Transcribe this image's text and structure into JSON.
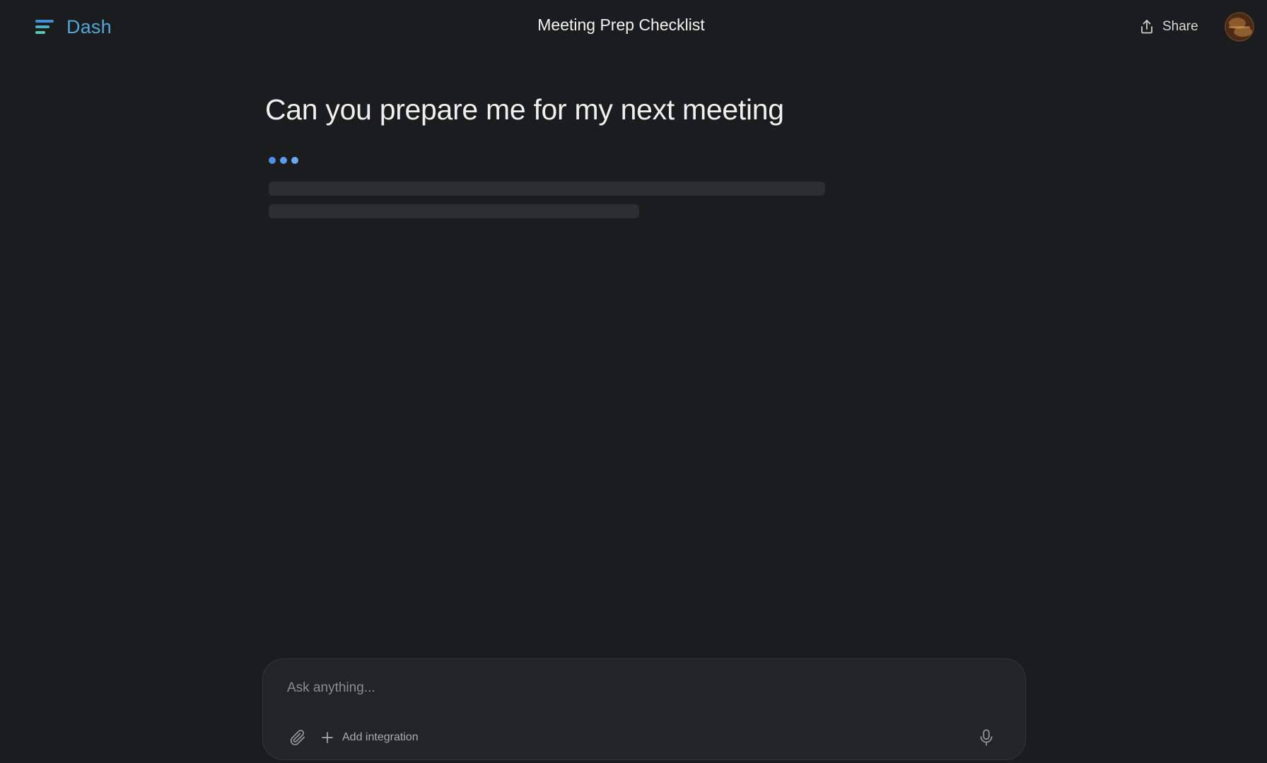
{
  "header": {
    "brand_name": "Dash",
    "brand_icon": "stacked-lines-logo-icon",
    "title": "Meeting Prep Checklist",
    "share_label": "Share",
    "share_icon": "share-upload-icon",
    "avatar_icon": "user-avatar"
  },
  "conversation": {
    "question": "Can you prepare me for my next meeting",
    "status": "loading",
    "typing_indicator_icon": "typing-dots-icon"
  },
  "composer": {
    "placeholder": "Ask anything...",
    "value": "",
    "attach_icon": "paperclip-icon",
    "add_integration_label": "Add integration",
    "add_icon": "plus-icon",
    "mic_icon": "microphone-icon"
  },
  "colors": {
    "background": "#1b1c1d",
    "brand": "#4fa6d9",
    "accent_dots": "#5a9bef",
    "composer_bg": "#232425",
    "skeleton": "#2b2e32"
  }
}
